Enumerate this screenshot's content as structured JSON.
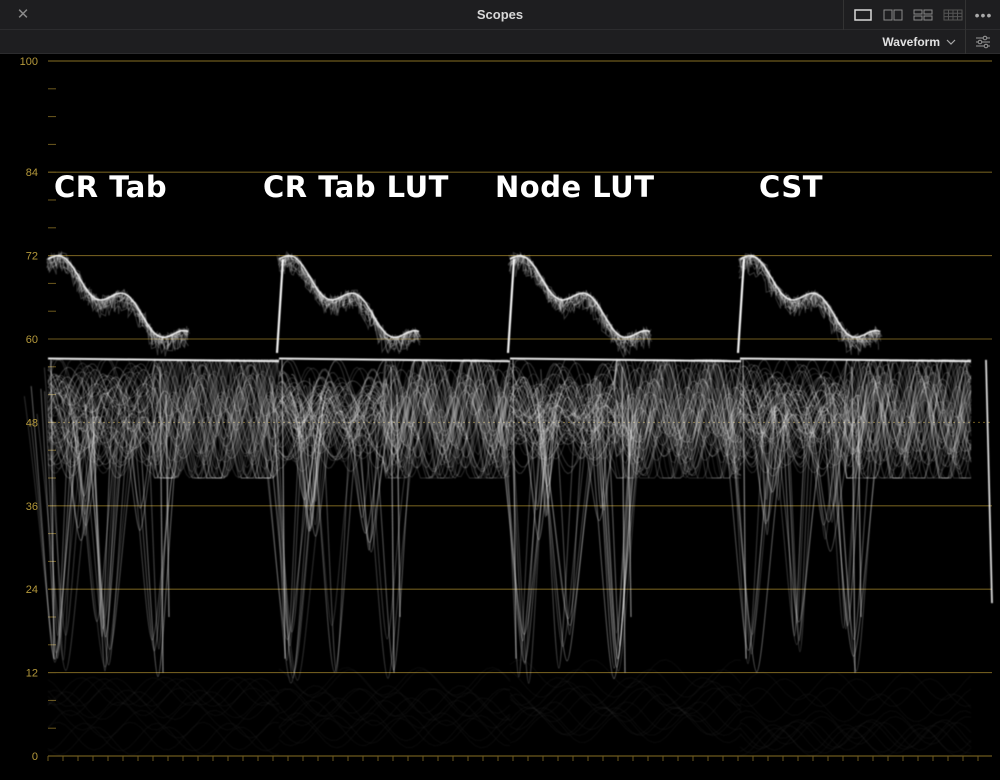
{
  "window": {
    "title": "Scopes"
  },
  "toolbar": {
    "scope_type": "Waveform"
  },
  "scale": {
    "labels": [
      "100",
      "84",
      "72",
      "60",
      "48",
      "36",
      "24",
      "12",
      "0"
    ]
  },
  "comparison_labels": [
    "CR Tab",
    "CR Tab LUT",
    "Node LUT",
    "CST"
  ],
  "colors": {
    "graticule": "#6e5a1e",
    "graticule_label": "#b5993b",
    "trace": "#ffffff",
    "panel": "#1e1e20"
  },
  "icons": {
    "close": "close-icon",
    "menu": "more-options-icon",
    "settings": "settings-sliders-icon",
    "chevron": "chevron-down-icon"
  }
}
